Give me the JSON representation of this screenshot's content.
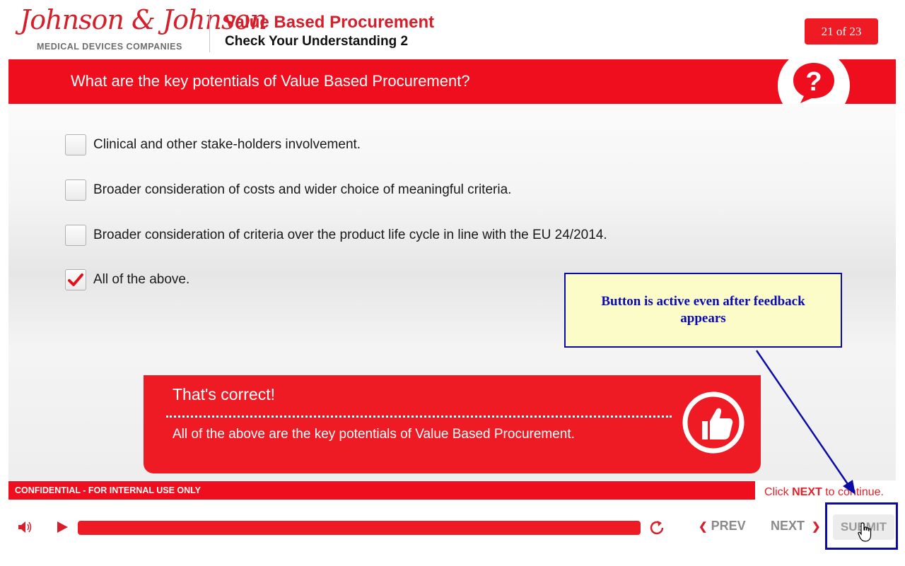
{
  "header": {
    "logo_script": "Johnson & Johnson",
    "logo_sub": "MEDICAL DEVICES COMPANIES",
    "course_title": "Value Based Procurement",
    "course_subtitle": "Check Your Understanding 2",
    "page_counter": "21 of 23"
  },
  "question": {
    "text": "What are the key potentials of Value Based Procurement?",
    "icon": "question-mark-icon"
  },
  "options": [
    {
      "label": "Clinical and other stake-holders involvement.",
      "checked": false
    },
    {
      "label": "Broader consideration of costs and wider choice of meaningful criteria.",
      "checked": false
    },
    {
      "label": "Broader consideration of criteria over the product life cycle in line with the EU 24/2014.",
      "checked": false
    },
    {
      "label": "All of the above.",
      "checked": true
    }
  ],
  "annotation": {
    "text": "Button is active even after feedback appears"
  },
  "feedback": {
    "title": "That's correct!",
    "body": "All of the above are the key potentials of Value Based Procurement.",
    "icon": "thumbs-up-icon"
  },
  "footer": {
    "confidential": "CONFIDENTIAL - FOR INTERNAL USE ONLY",
    "hint_prefix": "Click ",
    "hint_bold": "NEXT",
    "hint_suffix": " to continue."
  },
  "player": {
    "progress": 1.0,
    "prev_label": "PREV",
    "next_label": "NEXT",
    "submit_label": "SUBMIT"
  },
  "colors": {
    "brand_red": "#ee1b24",
    "annotation_blue": "#0b0ba8",
    "annotation_fill": "#fcfcc8"
  }
}
